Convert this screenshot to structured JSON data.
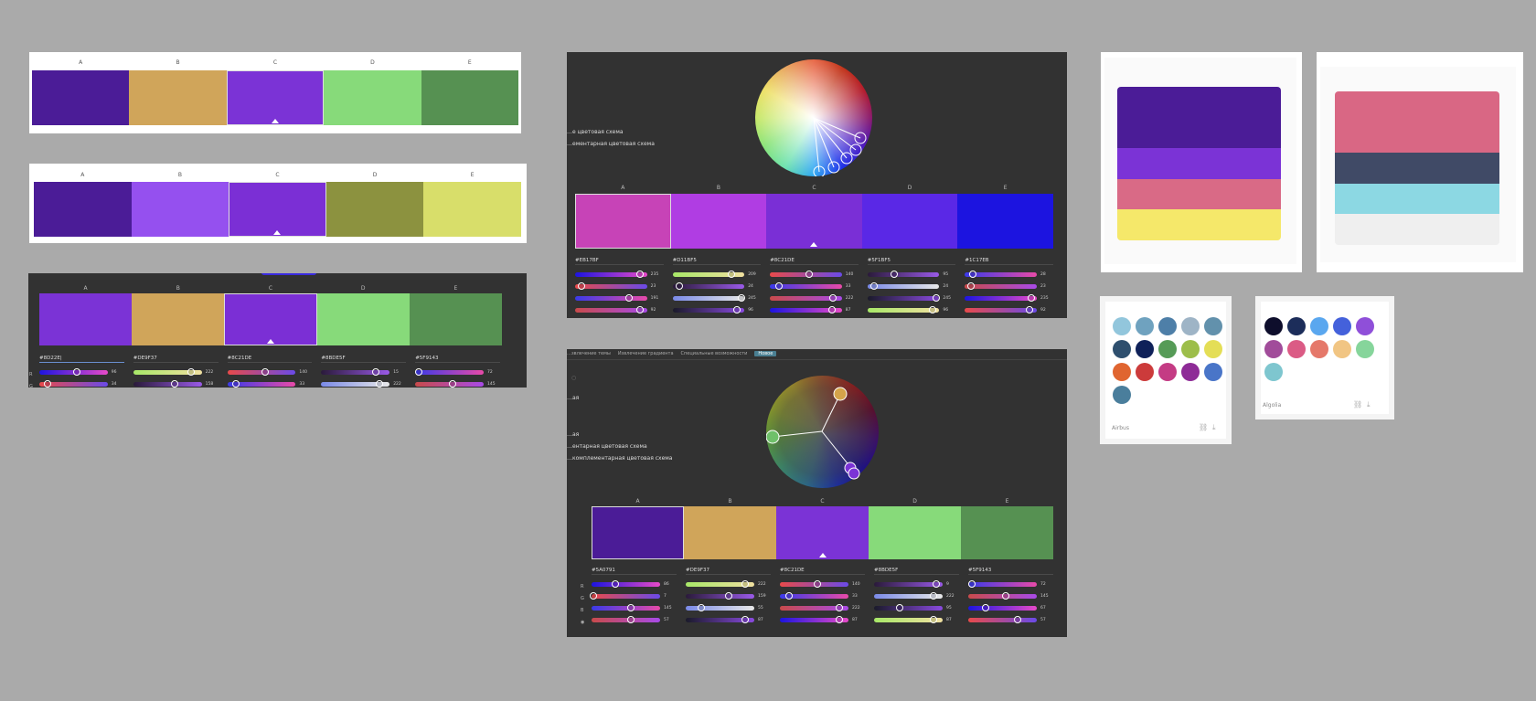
{
  "letters": [
    "A",
    "B",
    "C",
    "D",
    "E"
  ],
  "palette1": {
    "colors": [
      "#4B1C97",
      "#D0A55A",
      "#7B33D6",
      "#87DA7A",
      "#569152"
    ]
  },
  "palette2": {
    "colors": [
      "#4B1C97",
      "#9550EF",
      "#7B2FD5",
      "#8C923F",
      "#D8DE6A"
    ]
  },
  "palette3": {
    "colors": [
      "#7B33D6",
      "#D0A55A",
      "#7B2FD5",
      "#87DA7A",
      "#569152"
    ],
    "hex": [
      "#8D22E|",
      "#DE9F37",
      "#8C21DE",
      "#8BDE5F",
      "#5F9143"
    ],
    "rows": [
      [
        {
          "v": "96",
          "p": 0.55
        },
        {
          "v": "34",
          "p": 0.12
        }
      ],
      [
        {
          "v": "222",
          "p": 0.85
        },
        {
          "v": "158",
          "p": 0.6
        }
      ],
      [
        {
          "v": "140",
          "p": 0.55
        },
        {
          "v": "33",
          "p": 0.12
        }
      ],
      [
        {
          "v": "15",
          "p": 0.8
        },
        {
          "v": "222",
          "p": 0.85
        }
      ],
      [
        {
          "v": "72",
          "p": 0.05
        },
        {
          "v": "145",
          "p": 0.55
        }
      ]
    ],
    "row_labels": [
      "R",
      "G"
    ]
  },
  "panel_top": {
    "menu": [
      "…е цветовая схема",
      "…ементарная цветовая схема"
    ],
    "colors": [
      "#C743B7",
      "#B03DE3",
      "#7A2FD6",
      "#5A28E6",
      "#1C14E0"
    ],
    "hex": [
      "#EB17BF",
      "#D11BF5",
      "#8C21DE",
      "#5F1BF5",
      "#1C17EB"
    ],
    "sliders": [
      [
        {
          "v": "235",
          "p": 0.9
        },
        {
          "v": "23",
          "p": 0.09
        },
        {
          "v": "191",
          "p": 0.75
        },
        {
          "v": "92",
          "p": 0.9
        }
      ],
      [
        {
          "v": "209",
          "p": 0.82
        },
        {
          "v": "24",
          "p": 0.09
        },
        {
          "v": "245",
          "p": 0.96
        },
        {
          "v": "96",
          "p": 0.9
        }
      ],
      [
        {
          "v": "140",
          "p": 0.55
        },
        {
          "v": "33",
          "p": 0.13
        },
        {
          "v": "222",
          "p": 0.87
        },
        {
          "v": "87",
          "p": 0.86
        }
      ],
      [
        {
          "v": "95",
          "p": 0.37
        },
        {
          "v": "24",
          "p": 0.09
        },
        {
          "v": "245",
          "p": 0.96
        },
        {
          "v": "96",
          "p": 0.9
        }
      ],
      [
        {
          "v": "28",
          "p": 0.11
        },
        {
          "v": "23",
          "p": 0.09
        },
        {
          "v": "235",
          "p": 0.92
        },
        {
          "v": "92",
          "p": 0.9
        }
      ]
    ]
  },
  "panel_bottom": {
    "tabs": [
      "…звлечение темы",
      "Извлечение градиента",
      "Специальные возможности",
      "Новое"
    ],
    "menu": [
      "…ая",
      "…ая",
      "…ентарная цветовая схема",
      "…комплементарная цветовая схема"
    ],
    "colors": [
      "#4B1C97",
      "#D0A55A",
      "#7B33D6",
      "#87DA7A",
      "#569152"
    ],
    "hex": [
      "#5A0791",
      "#DE9F37",
      "#8C21DE",
      "#8BDE5F",
      "#5F9143"
    ],
    "row_labels": [
      "R",
      "G",
      "B",
      "◉"
    ],
    "sliders": [
      [
        {
          "v": "86",
          "p": 0.34
        },
        {
          "v": "7",
          "p": 0.03
        },
        {
          "v": "145",
          "p": 0.57
        },
        {
          "v": "57",
          "p": 0.57
        }
      ],
      [
        {
          "v": "222",
          "p": 0.87
        },
        {
          "v": "159",
          "p": 0.62
        },
        {
          "v": "55",
          "p": 0.22
        },
        {
          "v": "87",
          "p": 0.87
        }
      ],
      [
        {
          "v": "140",
          "p": 0.55
        },
        {
          "v": "33",
          "p": 0.13
        },
        {
          "v": "222",
          "p": 0.87
        },
        {
          "v": "87",
          "p": 0.87
        }
      ],
      [
        {
          "v": "9",
          "p": 0.9
        },
        {
          "v": "222",
          "p": 0.87
        },
        {
          "v": "95",
          "p": 0.37
        },
        {
          "v": "87",
          "p": 0.87
        }
      ],
      [
        {
          "v": "72",
          "p": 0.05
        },
        {
          "v": "145",
          "p": 0.55
        },
        {
          "v": "67",
          "p": 0.25
        },
        {
          "v": "57",
          "p": 0.72
        }
      ]
    ]
  },
  "card_bars_1": {
    "colors": [
      "#4B1C97",
      "#7B33D6",
      "#D96A86",
      "#F5E86A"
    ]
  },
  "card_bars_2": {
    "colors": [
      "#D96784",
      "#404A66",
      "#8CD8E3",
      "#EFEFEF"
    ]
  },
  "card_airbus": {
    "name": "Airbus",
    "dots": [
      "#92C6DC",
      "#6FA2BF",
      "#4E7FA8",
      "#9EB4C6",
      "#6291AC",
      "#2E4F6E",
      "#0F2159",
      "#569B57",
      "#9DBE4A",
      "#E4DE56",
      "#E06530",
      "#CC3B3B",
      "#C43B84",
      "#8E2B97",
      "#4975C8",
      "#4A7E9C"
    ]
  },
  "card_algolia": {
    "name": "Algolia",
    "dots": [
      "#0E0E2C",
      "#1C2D5A",
      "#5AA7EF",
      "#4461DB",
      "#8F4FD9",
      "#A14C9A",
      "#DB5B85",
      "#E5786A",
      "#F1C583",
      "#86D59B",
      "#7EC6CF"
    ]
  }
}
